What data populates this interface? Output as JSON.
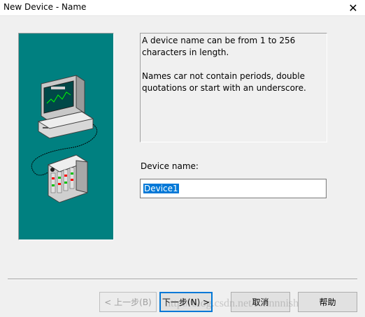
{
  "window": {
    "title": "New Device - Name",
    "close_glyph": "✕"
  },
  "info": {
    "line1": "A device name can be from 1 to 256 characters in length.",
    "line2": "Names car not contain periods, double quotations or start with an underscore."
  },
  "device_name": {
    "label": "Device name:",
    "value": "Device1"
  },
  "buttons": {
    "back": "< 上一步(B)",
    "next": "下一步(N) >",
    "cancel": "取消",
    "help": "帮助"
  },
  "watermark": "http://blog.csdn.net/lonnnnish",
  "colors": {
    "illustration_bg": "#008080",
    "selection": "#0078d7"
  }
}
